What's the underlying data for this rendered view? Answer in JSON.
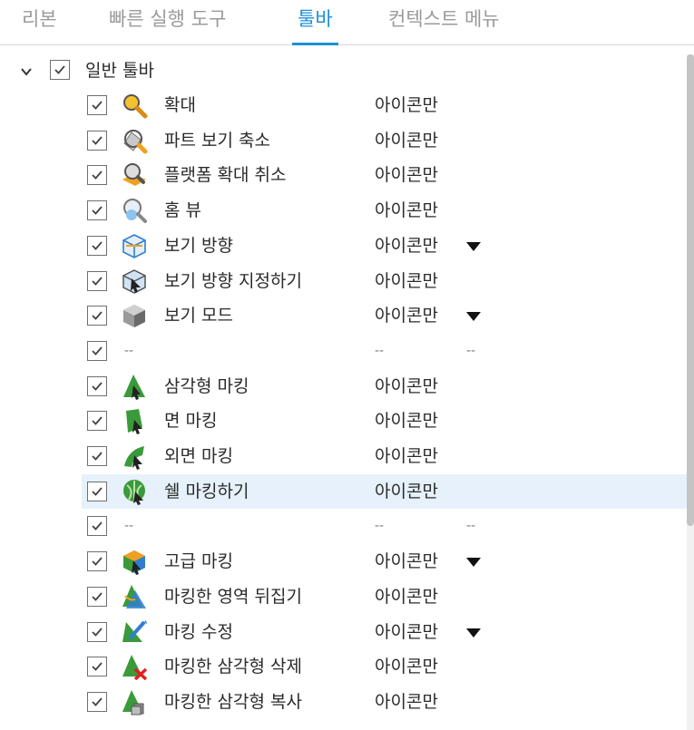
{
  "tabs": [
    {
      "label": "리본",
      "active": false
    },
    {
      "label": "빠른 실행 도구",
      "active": false
    },
    {
      "label": "툴바",
      "active": true
    },
    {
      "label": "컨텍스트 메뉴",
      "active": false
    }
  ],
  "group": {
    "label": "일반 툴바",
    "checked": true,
    "expanded": true
  },
  "rows": [
    {
      "label": "확대",
      "mode": "아이콘만",
      "icon": "zoom-icon",
      "dropdown": false
    },
    {
      "label": "파트 보기 축소",
      "mode": "아이콘만",
      "icon": "zoom-out-part-icon",
      "dropdown": false
    },
    {
      "label": "플랫폼 확대 취소",
      "mode": "아이콘만",
      "icon": "platform-zoom-reset-icon",
      "dropdown": false
    },
    {
      "label": "홈 뷰",
      "mode": "아이콘만",
      "icon": "home-view-icon",
      "dropdown": false
    },
    {
      "label": "보기 방향",
      "mode": "아이콘만",
      "icon": "view-direction-icon",
      "dropdown": true
    },
    {
      "label": "보기 방향 지정하기",
      "mode": "아이콘만",
      "icon": "set-view-direction-icon",
      "dropdown": false
    },
    {
      "label": "보기 모드",
      "mode": "아이콘만",
      "icon": "view-mode-icon",
      "dropdown": true
    },
    {
      "label": "--",
      "mode": "--",
      "extra": "--",
      "separator": true
    },
    {
      "label": "삼각형 마킹",
      "mode": "아이콘만",
      "icon": "triangle-marking-icon",
      "dropdown": false
    },
    {
      "label": "면 마킹",
      "mode": "아이콘만",
      "icon": "face-marking-icon",
      "dropdown": false
    },
    {
      "label": "외면 마킹",
      "mode": "아이콘만",
      "icon": "outer-face-marking-icon",
      "dropdown": false
    },
    {
      "label": "쉘 마킹하기",
      "mode": "아이콘만",
      "icon": "shell-marking-icon",
      "dropdown": false,
      "selected": true
    },
    {
      "label": "--",
      "mode": "--",
      "extra": "--",
      "separator": true
    },
    {
      "label": "고급 마킹",
      "mode": "아이콘만",
      "icon": "advanced-marking-icon",
      "dropdown": true
    },
    {
      "label": "마킹한 영역 뒤집기",
      "mode": "아이콘만",
      "icon": "invert-marking-icon",
      "dropdown": false
    },
    {
      "label": "마킹 수정",
      "mode": "아이콘만",
      "icon": "edit-marking-icon",
      "dropdown": true
    },
    {
      "label": "마킹한 삼각형 삭제",
      "mode": "아이콘만",
      "icon": "delete-marked-triangles-icon",
      "dropdown": false
    },
    {
      "label": "마킹한 삼각형 복사",
      "mode": "아이콘만",
      "icon": "copy-marked-triangles-icon",
      "dropdown": false
    }
  ],
  "colors": {
    "accent": "#1e90d8",
    "selected_row": "#e6f1fb",
    "icon_green": "#3a9a3a",
    "icon_orange": "#f0a020",
    "icon_blue": "#2f7fd0"
  }
}
